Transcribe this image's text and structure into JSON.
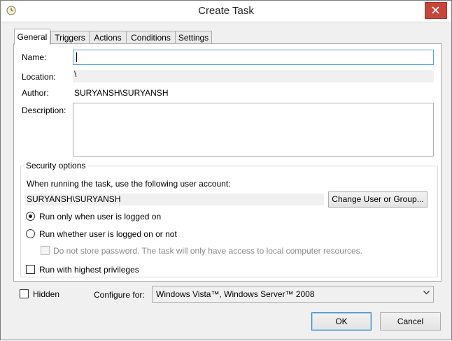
{
  "window": {
    "title": "Create Task"
  },
  "tabs": [
    {
      "label": "General"
    },
    {
      "label": "Triggers"
    },
    {
      "label": "Actions"
    },
    {
      "label": "Conditions"
    },
    {
      "label": "Settings"
    }
  ],
  "general": {
    "name_label": "Name:",
    "name_value": "",
    "location_label": "Location:",
    "location_value": "\\",
    "author_label": "Author:",
    "author_value": "SURYANSH\\SURYANSH",
    "description_label": "Description:",
    "description_value": ""
  },
  "security": {
    "group_title": "Security options",
    "account_prompt": "When running the task, use the following user account:",
    "account_value": "SURYANSH\\SURYANSH",
    "change_button": "Change User or Group...",
    "radio_logged_on": "Run only when user is logged on",
    "radio_logged_on_checked": true,
    "radio_whether": "Run whether user is logged on or not",
    "radio_whether_checked": false,
    "no_store_password": "Do not store password.  The task will only have access to local computer resources.",
    "highest_privileges": "Run with highest privileges"
  },
  "bottom": {
    "hidden_label": "Hidden",
    "configure_label": "Configure for:",
    "configure_value": "Windows Vista™, Windows Server™ 2008",
    "ok_button": "OK",
    "cancel_button": "Cancel"
  }
}
